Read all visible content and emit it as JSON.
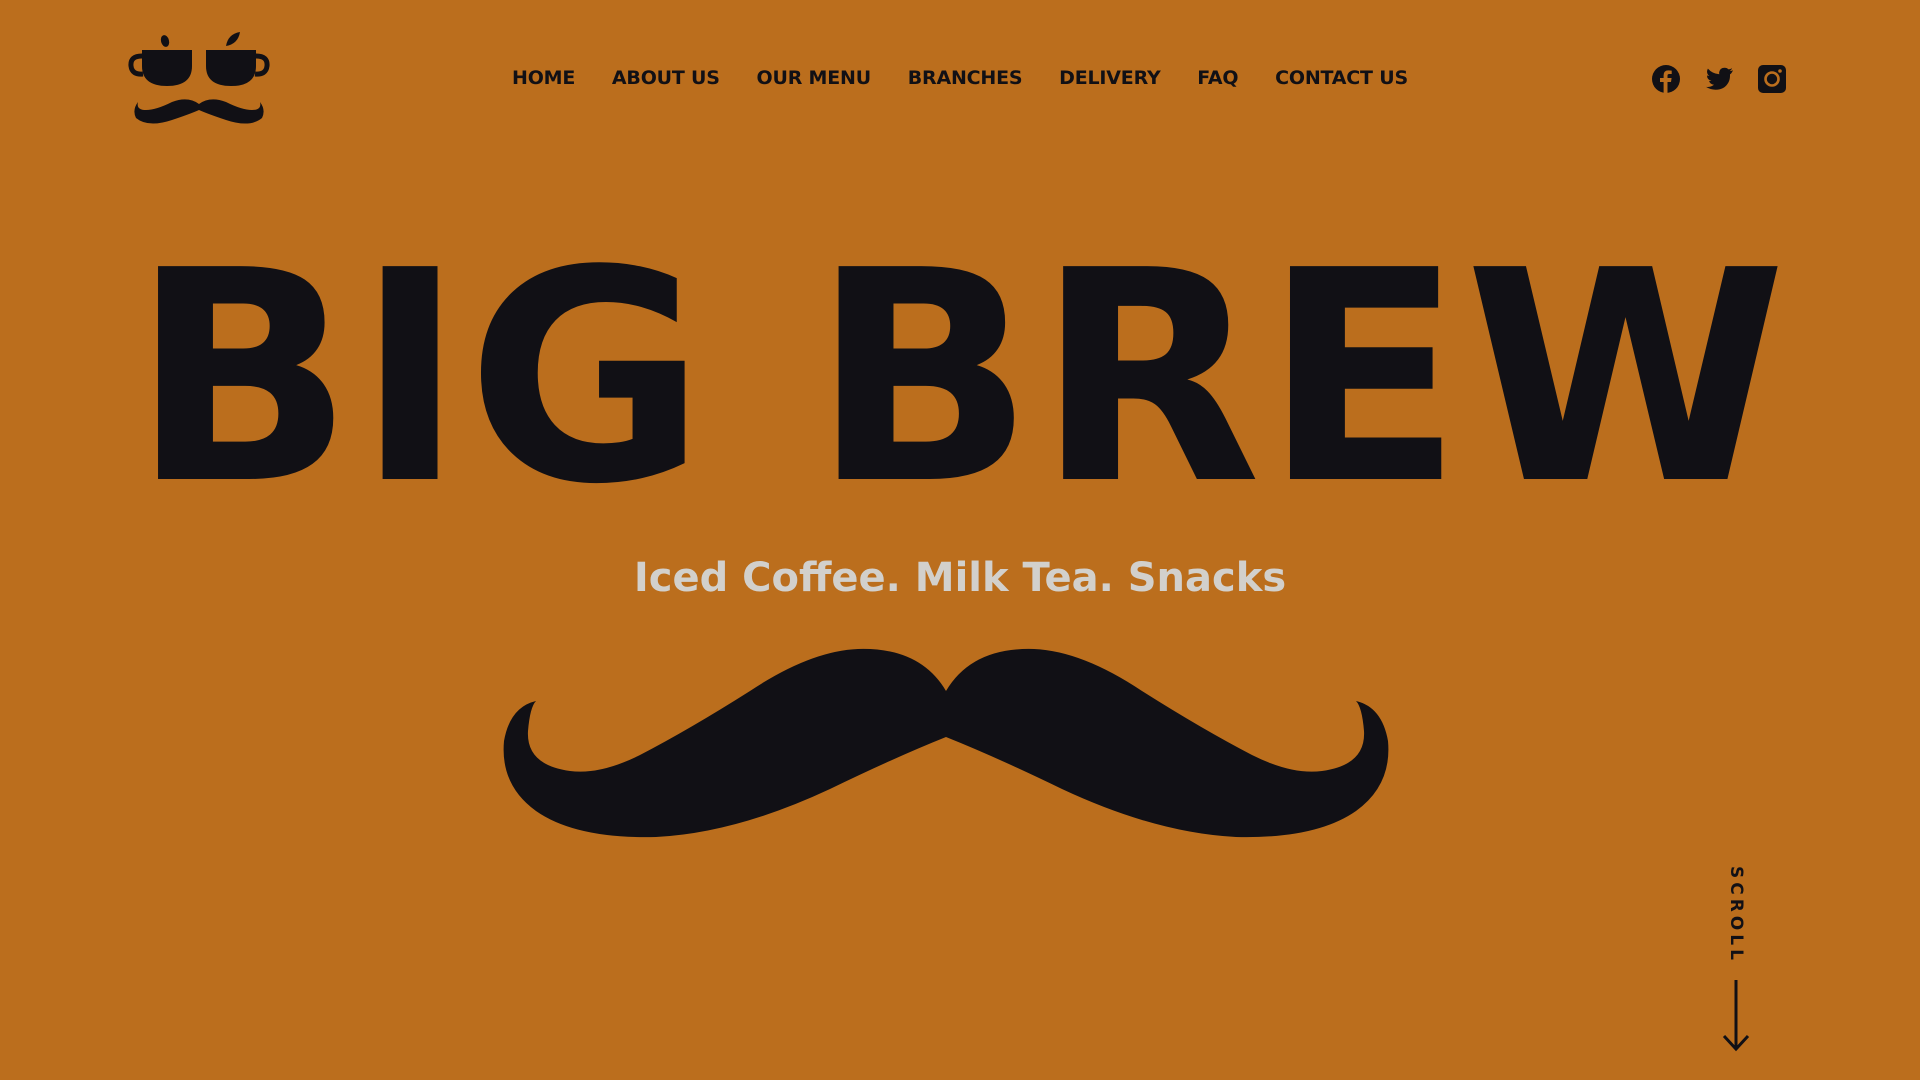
{
  "brand": {
    "logo_icon": "coffee-cups-mustache-logo",
    "background_color": "#BB6E1D",
    "text_color": "#111015",
    "tagline_color": "#D2D0CC"
  },
  "nav": {
    "items": [
      {
        "label": "HOME"
      },
      {
        "label": "ABOUT US"
      },
      {
        "label": "OUR MENU"
      },
      {
        "label": "BRANCHES"
      },
      {
        "label": "DELIVERY"
      },
      {
        "label": "FAQ"
      },
      {
        "label": "CONTACT US"
      }
    ]
  },
  "social": {
    "icons": [
      "facebook-icon",
      "twitter-icon",
      "instagram-icon"
    ]
  },
  "hero": {
    "title": "BIG BREW",
    "tagline": "Iced Coffee. Milk Tea. Snacks",
    "graphic_icon": "mustache-icon"
  },
  "scroll": {
    "label": "SCROLL",
    "arrow_icon": "arrow-down-icon"
  }
}
